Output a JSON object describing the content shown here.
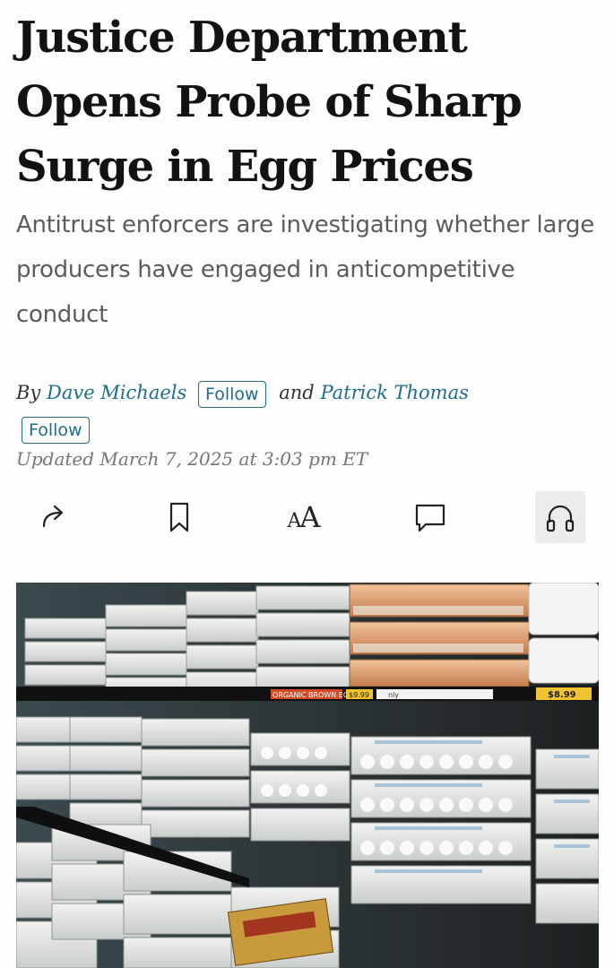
{
  "article": {
    "headline": "Justice Department Opens Probe of Sharp Surge in Egg Prices",
    "dek": "Antitrust enforcers are investigating whether large producers have engaged in anticompetitive conduct",
    "byline": {
      "by": "By",
      "author1": "Dave Michaels",
      "and": "and",
      "author2": "Patrick Thomas",
      "follow_label": "Follow"
    },
    "updated": "Updated March 7, 2025 at 3:03 pm ET"
  },
  "actions": {
    "share_icon": "share-arrow-icon",
    "bookmark_icon": "bookmark-icon",
    "text_size_label_small": "A",
    "text_size_label_large": "A",
    "comments_icon": "comment-bubble-icon",
    "listen_icon": "headphones-icon"
  },
  "photo": {
    "shelf_tags": [
      "$9.99",
      "$8.99",
      "nly",
      "ORGANIC BROWN EGGS"
    ]
  },
  "colors": {
    "link": "#1e6d8a",
    "headline": "#121212",
    "dek": "#5c5c5c",
    "meta": "#757575"
  }
}
